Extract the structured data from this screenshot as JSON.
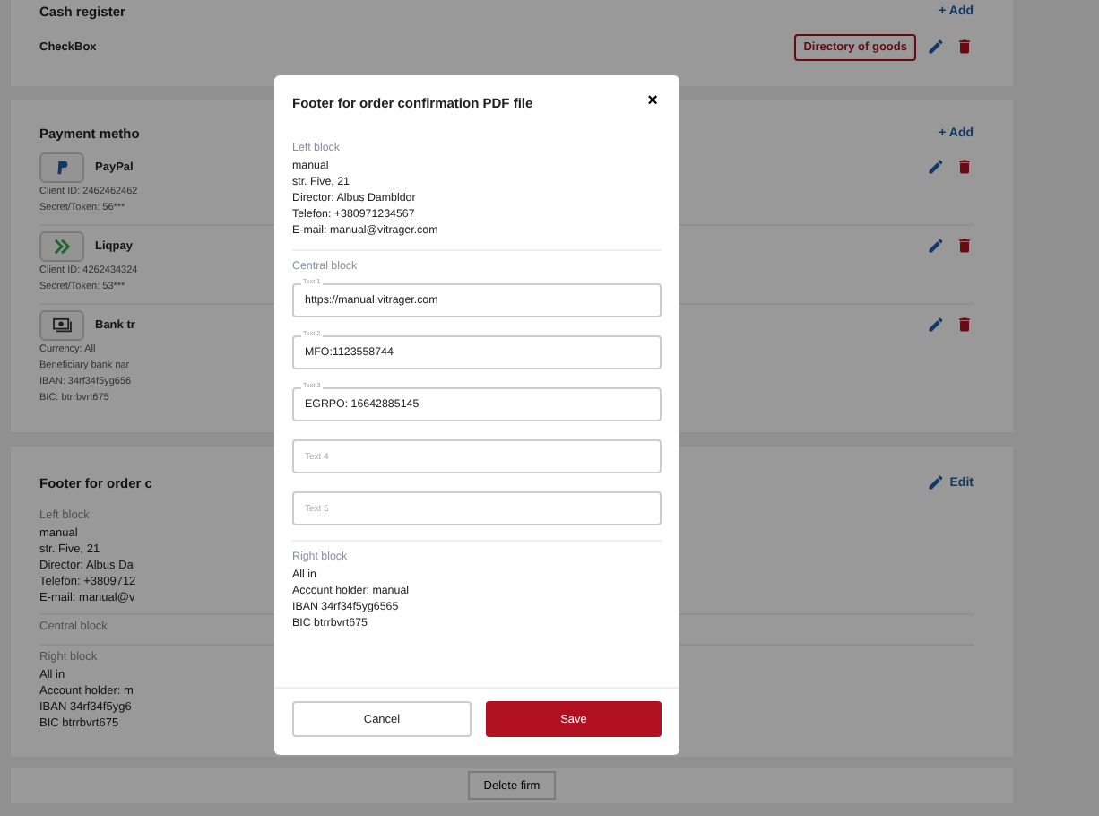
{
  "cash_register": {
    "title": "Cash register",
    "add": "+ Add",
    "item": {
      "name": "CheckBox",
      "directory_button": "Directory of goods"
    }
  },
  "payment_methods": {
    "title": "Payment metho",
    "add": "+ Add",
    "items": [
      {
        "kind": "paypal",
        "name": "PayPal",
        "details": [
          "Client ID: 2462462462",
          "Secret/Token: 56***"
        ]
      },
      {
        "kind": "liqpay",
        "name": "Liqpay",
        "details": [
          "Client ID: 4262434324",
          "Secret/Token: 53***"
        ]
      },
      {
        "kind": "bank",
        "name": "Bank tr",
        "details": [
          "Currency: All",
          "Beneficiary bank nar",
          "IBAN: 34rf34f5yg656",
          "BIC: btrrbvrt675"
        ]
      }
    ]
  },
  "footer_card": {
    "title": "Footer for order c",
    "edit": "Edit",
    "blocks": [
      {
        "label": "Left block",
        "lines": [
          "manual",
          "str. Five, 21",
          "Director: Albus Da",
          "Telefon: +3809712",
          "E-mail: manual@v"
        ]
      },
      {
        "label": "Central block"
      },
      {
        "label": "Right block",
        "lines": [
          "All in",
          "Account holder: m",
          "IBAN 34rf34f5yg6",
          "BIC btrrbvrt675"
        ]
      }
    ]
  },
  "delete_button": "Delete firm",
  "modal": {
    "title": "Footer for order confirmation PDF file",
    "close": "×",
    "left_block": {
      "label": "Left block",
      "lines": [
        "manual",
        "str. Five, 21",
        "Director: Albus Dambldor",
        "Telefon: +380971234567",
        "E-mail: manual@vitrager.com"
      ]
    },
    "central_block": {
      "label": "Central block",
      "fields": [
        {
          "label": "Text 1",
          "value": "https://manual.vitrager.com"
        },
        {
          "label": "Text 2",
          "value": "MFO:1123558744"
        },
        {
          "label": "Text 3",
          "value": "EGRPO: 16642885145"
        },
        {
          "placeholder": "Text 4"
        },
        {
          "placeholder": "Text 5"
        }
      ]
    },
    "right_block": {
      "label": "Right block",
      "lines": [
        "All in",
        "Account holder: manual",
        "IBAN 34rf34f5yg6565",
        "BIC btrrbvrt675"
      ]
    },
    "buttons": {
      "cancel": "Cancel",
      "save": "Save"
    }
  }
}
